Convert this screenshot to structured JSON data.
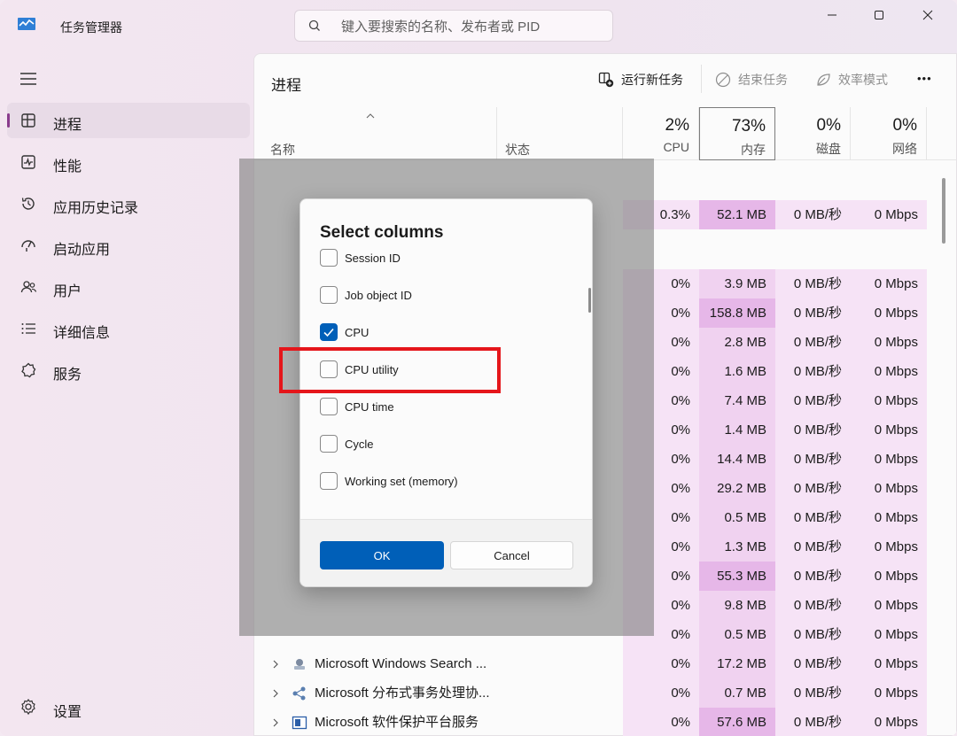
{
  "app": {
    "title": "任务管理器"
  },
  "search": {
    "placeholder": "键入要搜索的名称、发布者或 PID"
  },
  "window_controls": [
    "minimize",
    "maximize",
    "close"
  ],
  "sidebar": {
    "items": [
      {
        "label": "进程",
        "icon": "processes-icon",
        "active": true
      },
      {
        "label": "性能",
        "icon": "performance-icon",
        "active": false
      },
      {
        "label": "应用历史记录",
        "icon": "history-icon",
        "active": false
      },
      {
        "label": "启动应用",
        "icon": "startup-icon",
        "active": false
      },
      {
        "label": "用户",
        "icon": "users-icon",
        "active": false
      },
      {
        "label": "详细信息",
        "icon": "details-icon",
        "active": false
      },
      {
        "label": "服务",
        "icon": "services-icon",
        "active": false
      }
    ],
    "settings_label": "设置"
  },
  "toolbar": {
    "page_title": "进程",
    "run_new_task": "运行新任务",
    "end_task": "结束任务",
    "efficiency_mode": "效率模式",
    "more": "•••"
  },
  "columns": {
    "name": "名称",
    "status": "状态",
    "cpu": {
      "pct": "2%",
      "label": "CPU"
    },
    "memory": {
      "pct": "73%",
      "label": "内存"
    },
    "disk": {
      "pct": "0%",
      "label": "磁盘"
    },
    "network": {
      "pct": "0%",
      "label": "网络"
    }
  },
  "rows": [
    {
      "name": "",
      "cpu": "0.3%",
      "mem": "52.1 MB",
      "disk": "0 MB/秒",
      "net": "0 Mbps",
      "mem_hi": true
    },
    {
      "name": "",
      "cpu": "0%",
      "mem": "3.9 MB",
      "disk": "0 MB/秒",
      "net": "0 Mbps"
    },
    {
      "name": "",
      "cpu": "0%",
      "mem": "158.8 MB",
      "disk": "0 MB/秒",
      "net": "0 Mbps",
      "mem_hi": true
    },
    {
      "name": "",
      "cpu": "0%",
      "mem": "2.8 MB",
      "disk": "0 MB/秒",
      "net": "0 Mbps"
    },
    {
      "name": "",
      "cpu": "0%",
      "mem": "1.6 MB",
      "disk": "0 MB/秒",
      "net": "0 Mbps"
    },
    {
      "name": "",
      "cpu": "0%",
      "mem": "7.4 MB",
      "disk": "0 MB/秒",
      "net": "0 Mbps"
    },
    {
      "name": "",
      "cpu": "0%",
      "mem": "1.4 MB",
      "disk": "0 MB/秒",
      "net": "0 Mbps"
    },
    {
      "name": "",
      "cpu": "0%",
      "mem": "14.4 MB",
      "disk": "0 MB/秒",
      "net": "0 Mbps"
    },
    {
      "name": "",
      "cpu": "0%",
      "mem": "29.2 MB",
      "disk": "0 MB/秒",
      "net": "0 Mbps"
    },
    {
      "name": "",
      "cpu": "0%",
      "mem": "0.5 MB",
      "disk": "0 MB/秒",
      "net": "0 Mbps"
    },
    {
      "name": "",
      "cpu": "0%",
      "mem": "1.3 MB",
      "disk": "0 MB/秒",
      "net": "0 Mbps"
    },
    {
      "name": "",
      "cpu": "0%",
      "mem": "55.3 MB",
      "disk": "0 MB/秒",
      "net": "0 Mbps",
      "mem_hi": true
    },
    {
      "name": "",
      "cpu": "0%",
      "mem": "9.8 MB",
      "disk": "0 MB/秒",
      "net": "0 Mbps"
    },
    {
      "name": "",
      "cpu": "0%",
      "mem": "0.5 MB",
      "disk": "0 MB/秒",
      "net": "0 Mbps"
    },
    {
      "name": "Microsoft Windows Search ...",
      "cpu": "0%",
      "mem": "17.2 MB",
      "disk": "0 MB/秒",
      "net": "0 Mbps"
    },
    {
      "name": "Microsoft 分布式事务处理协...",
      "cpu": "0%",
      "mem": "0.7 MB",
      "disk": "0 MB/秒",
      "net": "0 Mbps"
    },
    {
      "name": "Microsoft 软件保护平台服务",
      "cpu": "0%",
      "mem": "57.6 MB",
      "disk": "0 MB/秒",
      "net": "0 Mbps",
      "mem_hi": true
    }
  ],
  "dialog": {
    "title": "Select columns",
    "options": [
      {
        "label": "Session ID",
        "checked": false
      },
      {
        "label": "Job object ID",
        "checked": false
      },
      {
        "label": "CPU",
        "checked": true
      },
      {
        "label": "CPU utility",
        "checked": false
      },
      {
        "label": "CPU time",
        "checked": false
      },
      {
        "label": "Cycle",
        "checked": false
      },
      {
        "label": "Working set (memory)",
        "checked": false
      }
    ],
    "ok_label": "OK",
    "cancel_label": "Cancel"
  },
  "colors": {
    "accent": "#005fb8",
    "highlight": "#e5161b",
    "nav_indicator": "#8a3b8c"
  }
}
